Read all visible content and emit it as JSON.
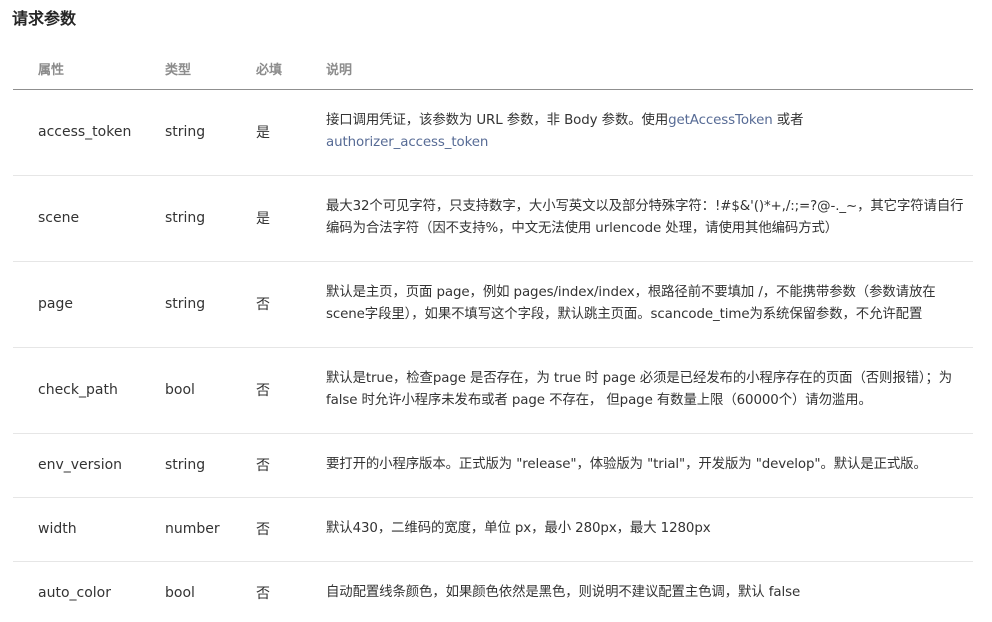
{
  "title": "请求参数",
  "headers": {
    "name": "属性",
    "type": "类型",
    "required": "必填",
    "description": "说明"
  },
  "rows": [
    {
      "name": "access_token",
      "type": "string",
      "required": "是",
      "desc_parts": [
        "接口调用凭证，该参数为 URL 参数，非 Body 参数。使用",
        "getAccessToken",
        " 或者 ",
        "authorizer_access_token"
      ]
    },
    {
      "name": "scene",
      "type": "string",
      "required": "是",
      "description": "最大32个可见字符，只支持数字，大小写英文以及部分特殊字符：!#$&'()*+,/:;=?@-._~，其它字符请自行编码为合法字符（因不支持%，中文无法使用 urlencode 处理，请使用其他编码方式）"
    },
    {
      "name": "page",
      "type": "string",
      "required": "否",
      "description": "默认是主页，页面 page，例如 pages/index/index，根路径前不要填加 /，不能携带参数（参数请放在scene字段里），如果不填写这个字段，默认跳主页面。scancode_time为系统保留参数，不允许配置"
    },
    {
      "name": "check_path",
      "type": "bool",
      "required": "否",
      "description": "默认是true，检查page 是否存在，为 true 时 page 必须是已经发布的小程序存在的页面（否则报错）；为 false 时允许小程序未发布或者 page 不存在， 但page 有数量上限（60000个）请勿滥用。"
    },
    {
      "name": "env_version",
      "type": "string",
      "required": "否",
      "description": "要打开的小程序版本。正式版为 \"release\"，体验版为 \"trial\"，开发版为 \"develop\"。默认是正式版。"
    },
    {
      "name": "width",
      "type": "number",
      "required": "否",
      "description": "默认430，二维码的宽度，单位 px，最小 280px，最大 1280px"
    },
    {
      "name": "auto_color",
      "type": "bool",
      "required": "否",
      "description": "自动配置线条颜色，如果颜色依然是黑色，则说明不建议配置主色调，默认 false"
    }
  ]
}
